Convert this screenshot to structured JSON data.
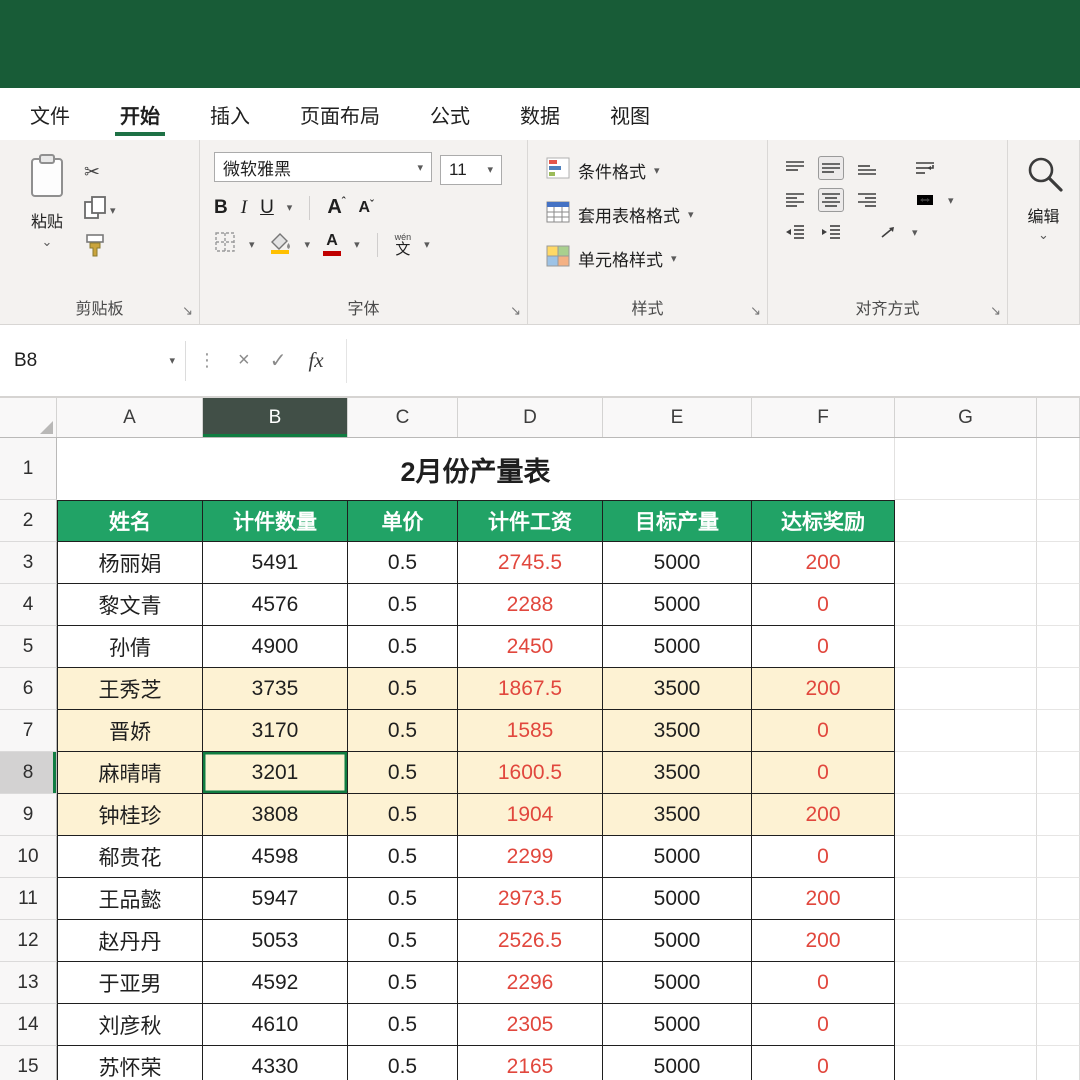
{
  "colors": {
    "titlebar": "#185C37",
    "accent_green": "#107C41",
    "table_header_fill": "#21A366",
    "band_fill": "#FDF2D3",
    "value_red": "#E1473D",
    "selected_col_header": "#414F47"
  },
  "ribbon": {
    "tabs": [
      {
        "label": "文件"
      },
      {
        "label": "开始",
        "active": true
      },
      {
        "label": "插入"
      },
      {
        "label": "页面布局"
      },
      {
        "label": "公式"
      },
      {
        "label": "数据"
      },
      {
        "label": "视图"
      }
    ],
    "clipboard": {
      "group_label": "剪贴板",
      "paste_label": "粘贴"
    },
    "font": {
      "group_label": "字体",
      "font_name": "微软雅黑",
      "font_size": "11",
      "bold": "B",
      "italic": "I",
      "underline": "U",
      "grow": "A",
      "shrink": "A",
      "phonetic_pinyin": "wén",
      "phonetic_char": "文"
    },
    "styles": {
      "group_label": "样式",
      "conditional": "条件格式",
      "format_as_table": "套用表格格式",
      "cell_styles": "单元格样式"
    },
    "alignment": {
      "group_label": "对齐方式"
    },
    "editing": {
      "label": "编辑"
    }
  },
  "formula_bar": {
    "name_box": "B8",
    "cancel": "×",
    "enter": "✓",
    "fx": "fx",
    "value": ""
  },
  "icons": {
    "dropdown": "▾",
    "small_dropdown": "⌄",
    "launcher": "↘",
    "cut": "✂",
    "grip": "⋮"
  },
  "sheet": {
    "selected_cell": "B8",
    "columns": [
      "A",
      "B",
      "C",
      "D",
      "E",
      "F",
      "G"
    ],
    "title_row_num": "1",
    "header_row_num": "2",
    "title": "2月份产量表",
    "headers": [
      "姓名",
      "计件数量",
      "单价",
      "计件工资",
      "目标产量",
      "达标奖励"
    ],
    "rows": [
      {
        "num": "3",
        "name": "杨丽娟",
        "qty": "5491",
        "price": "0.5",
        "wage": "2745.5",
        "target": "5000",
        "bonus": "200",
        "band": false
      },
      {
        "num": "4",
        "name": "黎文青",
        "qty": "4576",
        "price": "0.5",
        "wage": "2288",
        "target": "5000",
        "bonus": "0",
        "band": false
      },
      {
        "num": "5",
        "name": "孙倩",
        "qty": "4900",
        "price": "0.5",
        "wage": "2450",
        "target": "5000",
        "bonus": "0",
        "band": false
      },
      {
        "num": "6",
        "name": "王秀芝",
        "qty": "3735",
        "price": "0.5",
        "wage": "1867.5",
        "target": "3500",
        "bonus": "200",
        "band": true
      },
      {
        "num": "7",
        "name": "晋娇",
        "qty": "3170",
        "price": "0.5",
        "wage": "1585",
        "target": "3500",
        "bonus": "0",
        "band": true
      },
      {
        "num": "8",
        "name": "麻晴晴",
        "qty": "3201",
        "price": "0.5",
        "wage": "1600.5",
        "target": "3500",
        "bonus": "0",
        "band": true,
        "selected": true
      },
      {
        "num": "9",
        "name": "钟桂珍",
        "qty": "3808",
        "price": "0.5",
        "wage": "1904",
        "target": "3500",
        "bonus": "200",
        "band": true
      },
      {
        "num": "10",
        "name": "郗贵花",
        "qty": "4598",
        "price": "0.5",
        "wage": "2299",
        "target": "5000",
        "bonus": "0",
        "band": false
      },
      {
        "num": "11",
        "name": "王品懿",
        "qty": "5947",
        "price": "0.5",
        "wage": "2973.5",
        "target": "5000",
        "bonus": "200",
        "band": false
      },
      {
        "num": "12",
        "name": "赵丹丹",
        "qty": "5053",
        "price": "0.5",
        "wage": "2526.5",
        "target": "5000",
        "bonus": "200",
        "band": false
      },
      {
        "num": "13",
        "name": "于亚男",
        "qty": "4592",
        "price": "0.5",
        "wage": "2296",
        "target": "5000",
        "bonus": "0",
        "band": false
      },
      {
        "num": "14",
        "name": "刘彦秋",
        "qty": "4610",
        "price": "0.5",
        "wage": "2305",
        "target": "5000",
        "bonus": "0",
        "band": false
      },
      {
        "num": "15",
        "name": "苏怀荣",
        "qty": "4330",
        "price": "0.5",
        "wage": "2165",
        "target": "5000",
        "bonus": "0",
        "band": false
      }
    ]
  }
}
